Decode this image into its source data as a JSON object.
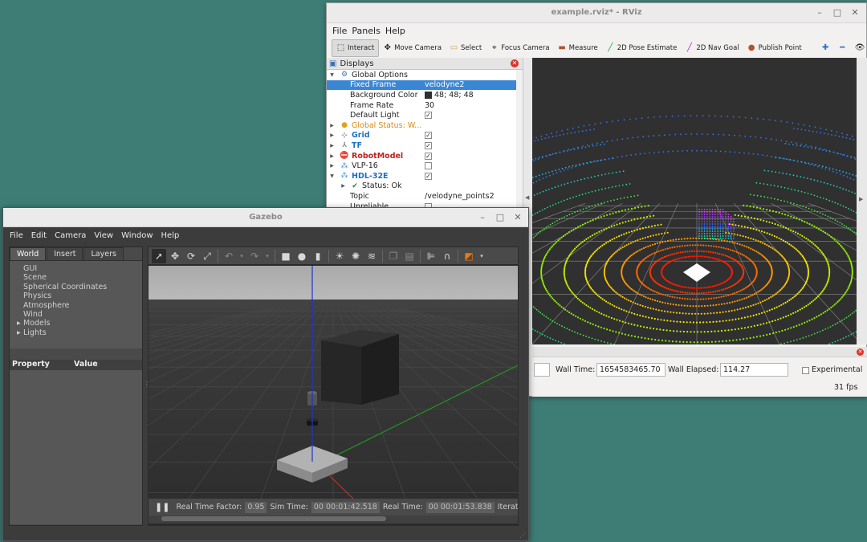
{
  "rviz": {
    "title": "example.rviz* - RViz",
    "menu": [
      "File",
      "Panels",
      "Help"
    ],
    "toolbar": {
      "interact": "Interact",
      "move_camera": "Move Camera",
      "select": "Select",
      "focus_camera": "Focus Camera",
      "measure": "Measure",
      "pose_estimate": "2D Pose Estimate",
      "nav_goal": "2D Nav Goal",
      "publish_point": "Publish Point"
    },
    "displays": {
      "title": "Displays",
      "global_options": "Global Options",
      "fixed_frame_label": "Fixed Frame",
      "fixed_frame_value": "velodyne2",
      "background_color_label": "Background Color",
      "background_color_value": "48; 48; 48",
      "frame_rate_label": "Frame Rate",
      "frame_rate_value": "30",
      "default_light_label": "Default Light",
      "global_status": "Global Status: W...",
      "grid": "Grid",
      "tf": "TF",
      "robot_model": "RobotModel",
      "vlp16": "VLP-16",
      "hdl32e": "HDL-32E",
      "status_ok": "Status: Ok",
      "topic_label": "Topic",
      "topic_value": "/velodyne_points2",
      "unreliable_label": "Unreliable"
    },
    "time": {
      "wall_time_label": "Wall Time:",
      "wall_time_value": "1654583465.70",
      "wall_elapsed_label": "Wall Elapsed:",
      "wall_elapsed_value": "114.27",
      "experimental_label": "Experimental",
      "fps": "31 fps"
    },
    "colors": {
      "background": "#303030",
      "selection": "#3a86d3"
    }
  },
  "gazebo": {
    "title": "Gazebo",
    "menu": [
      "File",
      "Edit",
      "Camera",
      "View",
      "Window",
      "Help"
    ],
    "tabs": [
      "World",
      "Insert",
      "Layers"
    ],
    "world_items": [
      "GUI",
      "Scene",
      "Spherical Coordinates",
      "Physics",
      "Atmosphere",
      "Wind",
      "Models",
      "Lights"
    ],
    "property_header": "Property",
    "value_header": "Value",
    "status": {
      "rtf_label": "Real Time Factor:",
      "rtf_value": "0.95",
      "sim_time_label": "Sim Time:",
      "sim_time_value": "00 00:01:42.518",
      "real_time_label": "Real Time:",
      "real_time_value": "00 00:01:53.838",
      "iterations_label": "Iterat"
    }
  }
}
